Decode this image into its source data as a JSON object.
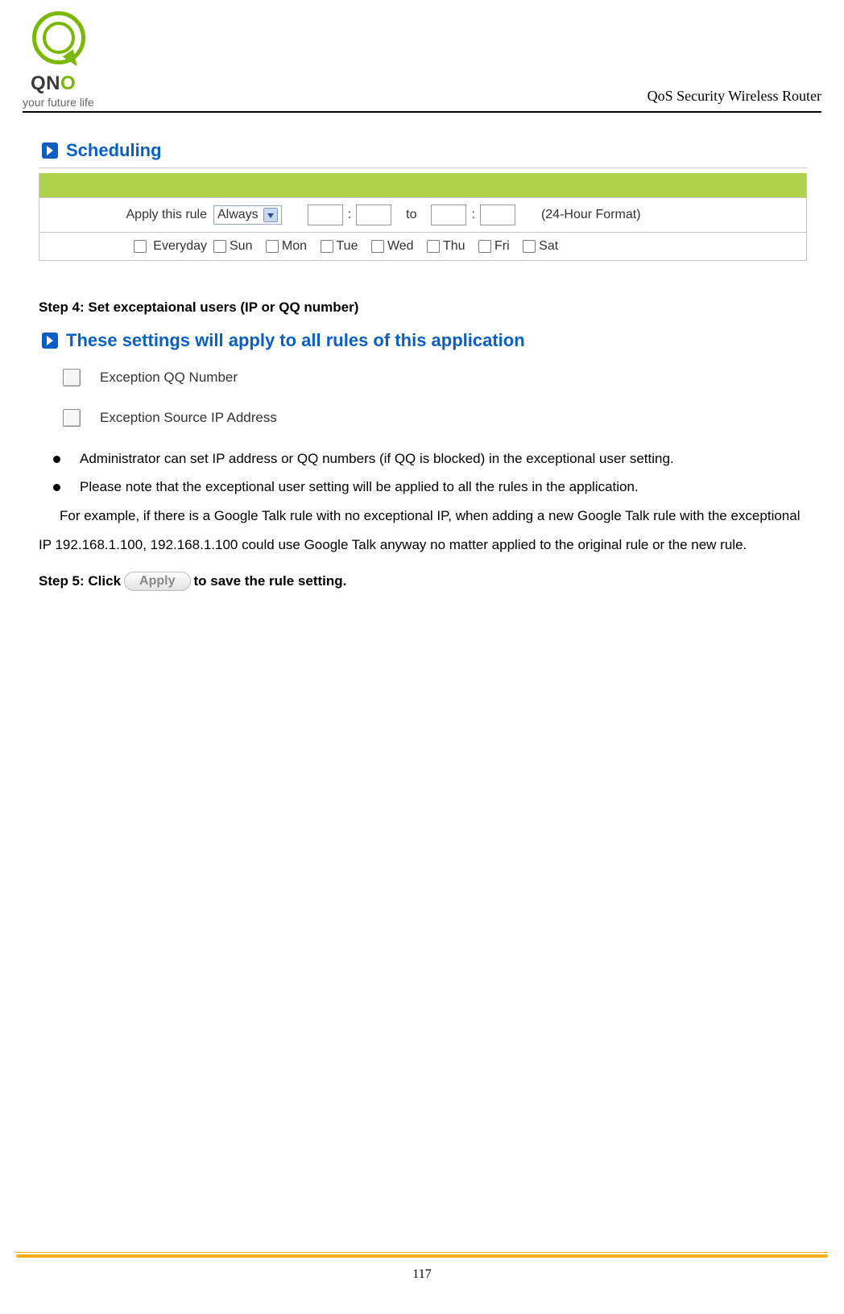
{
  "header": {
    "brand_letters": [
      "Q",
      "N",
      "O"
    ],
    "tagline": "your future life",
    "right_title": "QoS Security Wireless Router"
  },
  "scheduling": {
    "title": "Scheduling",
    "apply_label": "Apply this rule",
    "dropdown_value": "Always",
    "to_label": "to",
    "separator": ":",
    "format_hint": "(24-Hour Format)",
    "everyday_label": "Everyday",
    "days": [
      "Sun",
      "Mon",
      "Tue",
      "Wed",
      "Thu",
      "Fri",
      "Sat"
    ]
  },
  "step4": {
    "heading": "Step 4: Set exceptaional users (IP or QQ number)",
    "rules_title": "These settings will apply to all rules of this application",
    "exceptions": [
      "Exception QQ Number",
      "Exception Source IP Address"
    ],
    "bullets": [
      "Administrator can set IP address or QQ numbers (if QQ is blocked) in the exceptional user setting.",
      "Please note that the exceptional user setting will be applied to all the rules in the application."
    ],
    "example": "For example, if there is a Google Talk rule with no exceptional IP, when adding a new Google Talk rule with the exceptional IP 192.168.1.100, 192.168.1.100 could use Google Talk anyway no matter applied to the original rule or the new rule."
  },
  "step5": {
    "before": "Step 5: Click",
    "button": "Apply",
    "after": "to save the rule setting."
  },
  "footer": {
    "page_number": "117"
  }
}
